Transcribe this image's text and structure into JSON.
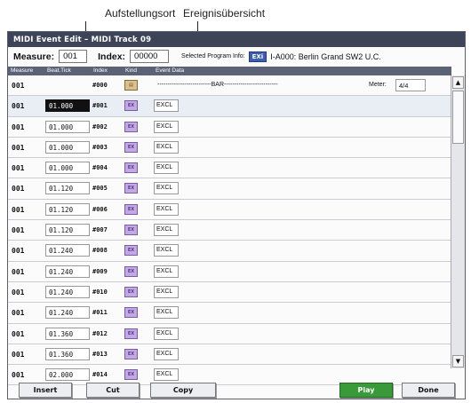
{
  "annotations": {
    "location": "Aufstellungsort",
    "overview": "Ereignisübersicht"
  },
  "window": {
    "title": "MIDI Event Edit – MIDI Track 09"
  },
  "info": {
    "measure_label": "Measure:",
    "measure_value": "001",
    "index_label": "Index:",
    "index_value": "00000",
    "program_label": "Selected Program Info:",
    "program_badge": "EXi",
    "program_name": "I-A000: Berlin Grand SW2 U.C."
  },
  "columns": [
    "Measure",
    "Beat.Tick",
    "Index",
    "Kind",
    "Event Data"
  ],
  "bar_row": {
    "measure": "001",
    "index": "#000",
    "dashes": "--------------------------BAR--------------------------",
    "meter_label": "Meter:",
    "meter_value": "4/4"
  },
  "rows": [
    {
      "measure": "001",
      "beat": "01.000",
      "index": "#001",
      "kind": "EX",
      "data": "EXCL"
    },
    {
      "measure": "001",
      "beat": "01.000",
      "index": "#002",
      "kind": "EX",
      "data": "EXCL"
    },
    {
      "measure": "001",
      "beat": "01.000",
      "index": "#003",
      "kind": "EX",
      "data": "EXCL"
    },
    {
      "measure": "001",
      "beat": "01.000",
      "index": "#004",
      "kind": "EX",
      "data": "EXCL"
    },
    {
      "measure": "001",
      "beat": "01.120",
      "index": "#005",
      "kind": "EX",
      "data": "EXCL"
    },
    {
      "measure": "001",
      "beat": "01.120",
      "index": "#006",
      "kind": "EX",
      "data": "EXCL"
    },
    {
      "measure": "001",
      "beat": "01.120",
      "index": "#007",
      "kind": "EX",
      "data": "EXCL"
    },
    {
      "measure": "001",
      "beat": "01.240",
      "index": "#008",
      "kind": "EX",
      "data": "EXCL"
    },
    {
      "measure": "001",
      "beat": "01.240",
      "index": "#009",
      "kind": "EX",
      "data": "EXCL"
    },
    {
      "measure": "001",
      "beat": "01.240",
      "index": "#010",
      "kind": "EX",
      "data": "EXCL"
    },
    {
      "measure": "001",
      "beat": "01.240",
      "index": "#011",
      "kind": "EX",
      "data": "EXCL"
    },
    {
      "measure": "001",
      "beat": "01.360",
      "index": "#012",
      "kind": "EX",
      "data": "EXCL"
    },
    {
      "measure": "001",
      "beat": "01.360",
      "index": "#013",
      "kind": "EX",
      "data": "EXCL"
    },
    {
      "measure": "001",
      "beat": "02.000",
      "index": "#014",
      "kind": "EX",
      "data": "EXCL"
    }
  ],
  "buttons": {
    "insert": "Insert",
    "cut": "Cut",
    "copy": "Copy",
    "play": "Play",
    "done": "Done"
  },
  "icons": {
    "scroll_up": "up-arrow-icon",
    "scroll_down": "down-arrow-icon",
    "bar_kind": "bar-kind-icon",
    "exclusive_kind": "exclusive-kind-icon"
  },
  "colors": {
    "titlebar": "#3e4458",
    "header": "#5c6276",
    "play_button": "#3a9a3a",
    "kind_exclusive": "#c3a9e4",
    "badge": "#3d5fb0"
  }
}
